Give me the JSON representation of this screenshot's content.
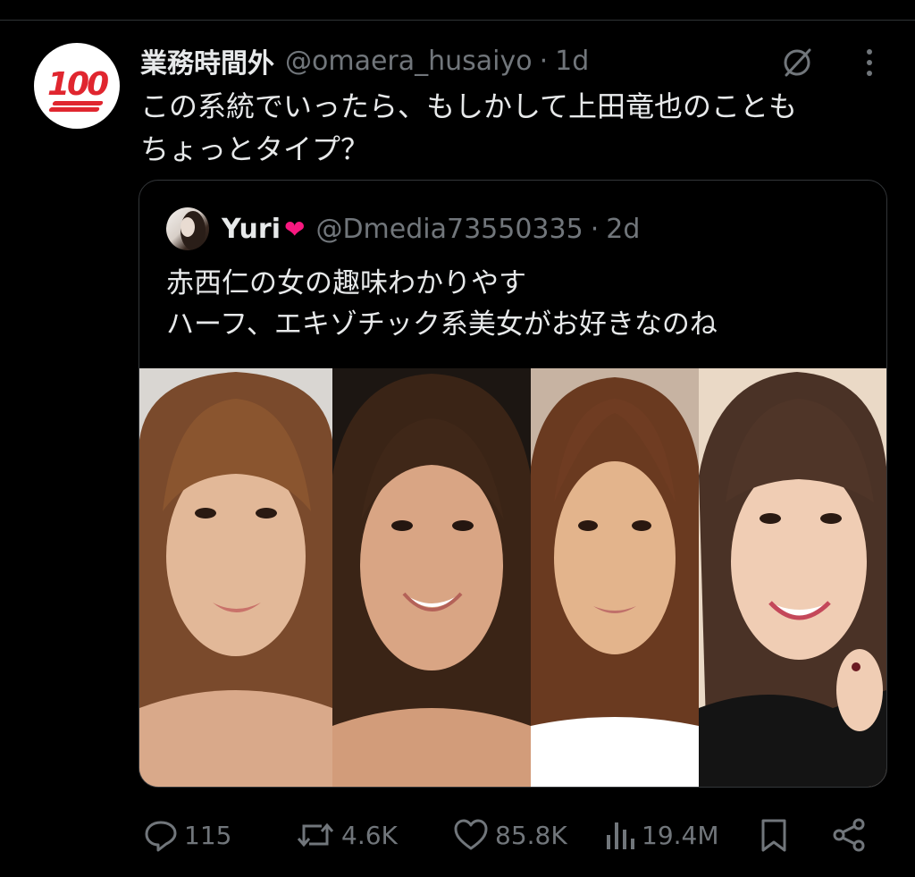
{
  "tweet": {
    "author_name": "業務時間外",
    "author_handle": "@omaera_husaiyo",
    "separator": "·",
    "time": "1d",
    "avatar_emoji_text": "100",
    "text_line1": "この系統でいったら、もしかして上田竜也のことも",
    "text_line2": "ちょっとタイプ？"
  },
  "quote": {
    "author_name": "Yuri",
    "author_handle": "@Dmedia73550335",
    "separator": "·",
    "time": "2d",
    "text_line1": "赤西仁の女の趣味わかりやす",
    "text_line2": "ハーフ、エキゾチック系美女がお好きなのね",
    "photo_count": 4
  },
  "actions": {
    "replies": "115",
    "reposts": "4.6K",
    "likes": "85.8K",
    "views": "19.4M"
  },
  "icons": [
    "reply-icon",
    "repost-icon",
    "like-icon",
    "views-icon",
    "bookmark-icon",
    "share-icon",
    "grok-icon",
    "more-icon"
  ],
  "colors": {
    "background": "#000000",
    "text": "#e7e9ea",
    "muted": "#71767b",
    "accent_red": "#e0262f",
    "heart": "#f91880"
  }
}
